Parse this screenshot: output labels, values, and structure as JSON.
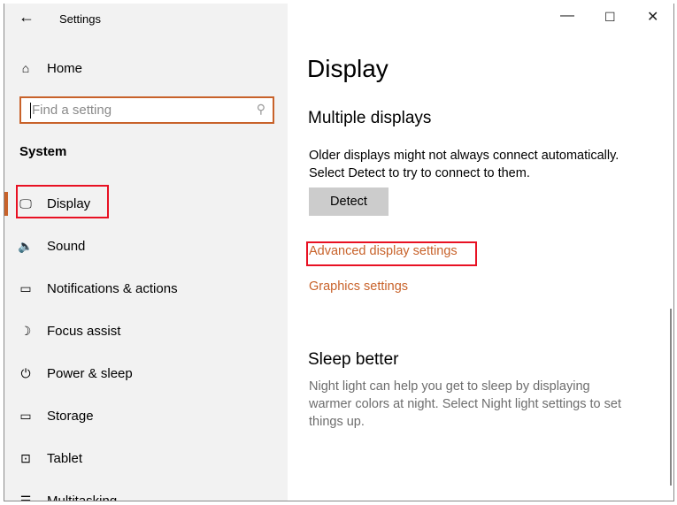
{
  "window": {
    "title": "Settings",
    "minimize": "—",
    "maximize": "☐",
    "close": "✕"
  },
  "sidebar": {
    "home": "Home",
    "search_placeholder": "Find a setting",
    "section": "System",
    "items": [
      {
        "label": "Display",
        "icon": "monitor-icon",
        "glyph": "🖵"
      },
      {
        "label": "Sound",
        "icon": "speaker-icon",
        "glyph": "🔈"
      },
      {
        "label": "Notifications & actions",
        "icon": "notification-icon",
        "glyph": "▭"
      },
      {
        "label": "Focus assist",
        "icon": "moon-icon",
        "glyph": "☽"
      },
      {
        "label": "Power & sleep",
        "icon": "power-icon",
        "glyph": "⏻"
      },
      {
        "label": "Storage",
        "icon": "storage-icon",
        "glyph": "▭"
      },
      {
        "label": "Tablet",
        "icon": "tablet-icon",
        "glyph": "⊡"
      },
      {
        "label": "Multitasking",
        "icon": "multitasking-icon",
        "glyph": "☰"
      }
    ]
  },
  "main": {
    "title": "Display",
    "multiple_displays": {
      "heading": "Multiple displays",
      "line1": "Older displays might not always connect automatically.",
      "line2": "Select Detect to try to connect to them.",
      "detect": "Detect"
    },
    "advanced_link": "Advanced display settings",
    "graphics_link": "Graphics settings",
    "sleep": {
      "heading": "Sleep better",
      "line1": "Night light can help you get to sleep by displaying",
      "line2": "warmer colors at night. Select Night light settings to set",
      "line3": "things up."
    }
  },
  "colors": {
    "accent": "#c8622a",
    "highlight": "#e81123"
  }
}
